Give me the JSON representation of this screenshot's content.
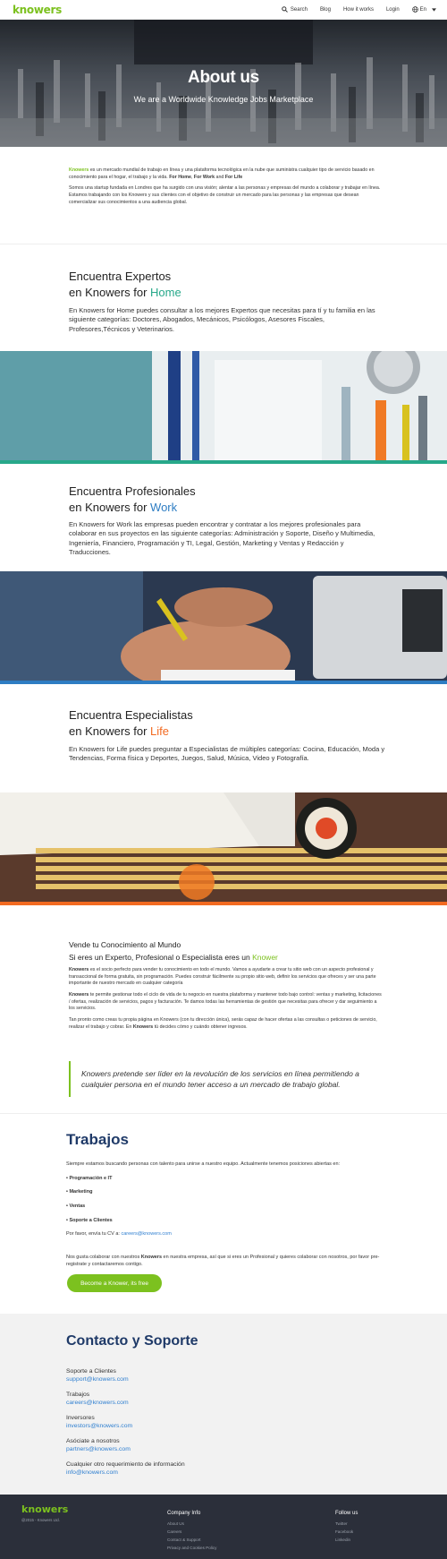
{
  "header": {
    "logo": "knowers",
    "nav": [
      "Search",
      "Blog",
      "How it works",
      "Login",
      "En"
    ]
  },
  "hero": {
    "title": "About us",
    "subtitle": "We are a Worldwide Knowledge Jobs Marketplace"
  },
  "intro": {
    "brand": "Knowers",
    "p1": " es un mercado mundial de trabajo en línea y una plataforma tecnológica en la nube que suministra cualquier tipo de servicio basado en conocimiento para el hogar, el trabajo y la vida. ",
    "p1_for_home": "For Home",
    "p1_sep1": ", ",
    "p1_for_work": "For Work",
    "p1_and": " and ",
    "p1_for_life": "For Life",
    "p2": "Somos una startup fundada en Londres que ha surgido con una visión; alentar a las personas y empresas del mundo a colaborar y trabajar en línea. Estamos trabajando con los Knowers y sus clientes con el objetivo de construir un mercado para las personas y las empresas que desean comercializar sus conocimientos a una audiencia global."
  },
  "home": {
    "title_line1": "Encuentra Expertos",
    "title_line2_prefix": "en Knowers for ",
    "title_accent": "Home",
    "body": "En Knowers for Home puedes consultar a los mejores Expertos que necesitas para tí y tu familia en las siguiente categorías: Doctores, Abogados, Mecánicos, Psicólogos, Asesores Fiscales, Profesores,Técnicos y Veterinarios."
  },
  "work": {
    "title_line1": "Encuentra Profesionales",
    "title_line2_prefix": "en Knowers for ",
    "title_accent": "Work",
    "body": "En Knowers for Work las empresas pueden encontrar y contratar a los mejores profesionales para colaborar en sus proyectos en las siguiente categorías: Administración y Soporte, Diseño y Multimedia, Ingeniería, Financiero, Programación y TI, Legal, Gestión, Marketing y Ventas y Redacción y Traducciones."
  },
  "life": {
    "title_line1": "Encuentra Especialistas",
    "title_line2_prefix": "en Knowers for ",
    "title_accent": "Life",
    "body": "En Knowers for Life puedes preguntar a Especialistas de múltiples categorías: Cocina, Educación, Moda y Tendencias, Forma física y Deportes, Juegos, Salud, Música, Video y Fotografía."
  },
  "vende": {
    "h1": "Vende tu Conocimiento al Mundo",
    "h2_prefix": "Si eres un Experto, Profesional o Especialista eres un ",
    "h2_accent": "Knower",
    "brand": "Knowers",
    "p1": " es el socio perfecto para vender tu conocimiento en todo el mundo. Vamos a ayudarte a crear tu sitio web con un aspecto profesional y transaccional de forma gratuita, sin programación. Puedes construir fácilmente su propio sitio web, definir los servicios que ofreces y ser una parte importante de nuestro mercado en cualquier categoría",
    "p2": " te permite gestionar todo el ciclo de vida de tu negocio en nuestra plataforma y mantener todo bajo control: ventas y marketing, licitaciones / ofertas, realización de servicios, pagos y facturación. Te damos todas las herramientas de gestión que necesitas para ofrecer y dar seguimiento a los servicios.",
    "p3_a": "Tan pronto como creas tu propia página en Knowers (con tu dirección única), serás capaz de hacer ofertas a las consultas o peticiones de servicio, realizar el trabajo y cobrar. En ",
    "p3_b": " tú decides cómo y cuándo obtener ingresos."
  },
  "quote": "Knowers pretende ser líder en la revolución de los servicios en línea permitiendo a cualquier persona en el mundo tener acceso a un mercado de trabajo global.",
  "trabajos": {
    "title": "Trabajos",
    "intro": "Siempre estamos buscando personas con talento para unirse a nuestro equipo. Actualmente tenemos posiciones abiertas en:",
    "positions": [
      "• Programación e IT",
      "• Marketing",
      "• Ventas",
      "• Soporte a Clientes"
    ],
    "cv_prefix": "Por favor, envía tu CV a: ",
    "cv_email": "careers@knowers.com",
    "collab_a": "Nos gusta colaborar con nuestros ",
    "collab_brand": "Knowers",
    "collab_b": " en nuestra empresa, así que si eres un Profesional y quieres colaborar con nosotros, por favor pre-registrate y contactaremos contigo.",
    "cta": "Become a Knower, its free"
  },
  "contacto": {
    "title": "Contacto y Soporte",
    "items": [
      {
        "label": "Soporte a Clientes",
        "email": "support@knowers.com"
      },
      {
        "label": "Trabajos",
        "email": "careers@knowers.com"
      },
      {
        "label": "Inversores",
        "email": "investors@knowers.com"
      },
      {
        "label": "Asóciate a nosotros",
        "email": "partners@knowers.com"
      },
      {
        "label": "Cualquier otro requerimiento de información",
        "email": "info@knowers.com"
      }
    ]
  },
  "footer": {
    "logo": "knowers",
    "copyright": "@2015 - Knowers Ltd.",
    "company_title": "Company Info",
    "company_links": [
      "About Us",
      "Careers",
      "Contact & Support",
      "Privacy and Cookies Policy"
    ],
    "follow_title": "Follow us",
    "follow_links": [
      "Twitter",
      "Facebook",
      "Linkedin"
    ]
  },
  "colors": {
    "brand_green": "#7cc11f",
    "home_accent": "#27a88a",
    "work_accent": "#2e7dc3",
    "life_accent": "#f26a21",
    "heading_navy": "#1f3a68",
    "link_blue": "#2f7fd0",
    "footer_bg": "#2b2f3a"
  },
  "icons": [
    "search-icon",
    "globe-icon",
    "caret-down-icon"
  ]
}
